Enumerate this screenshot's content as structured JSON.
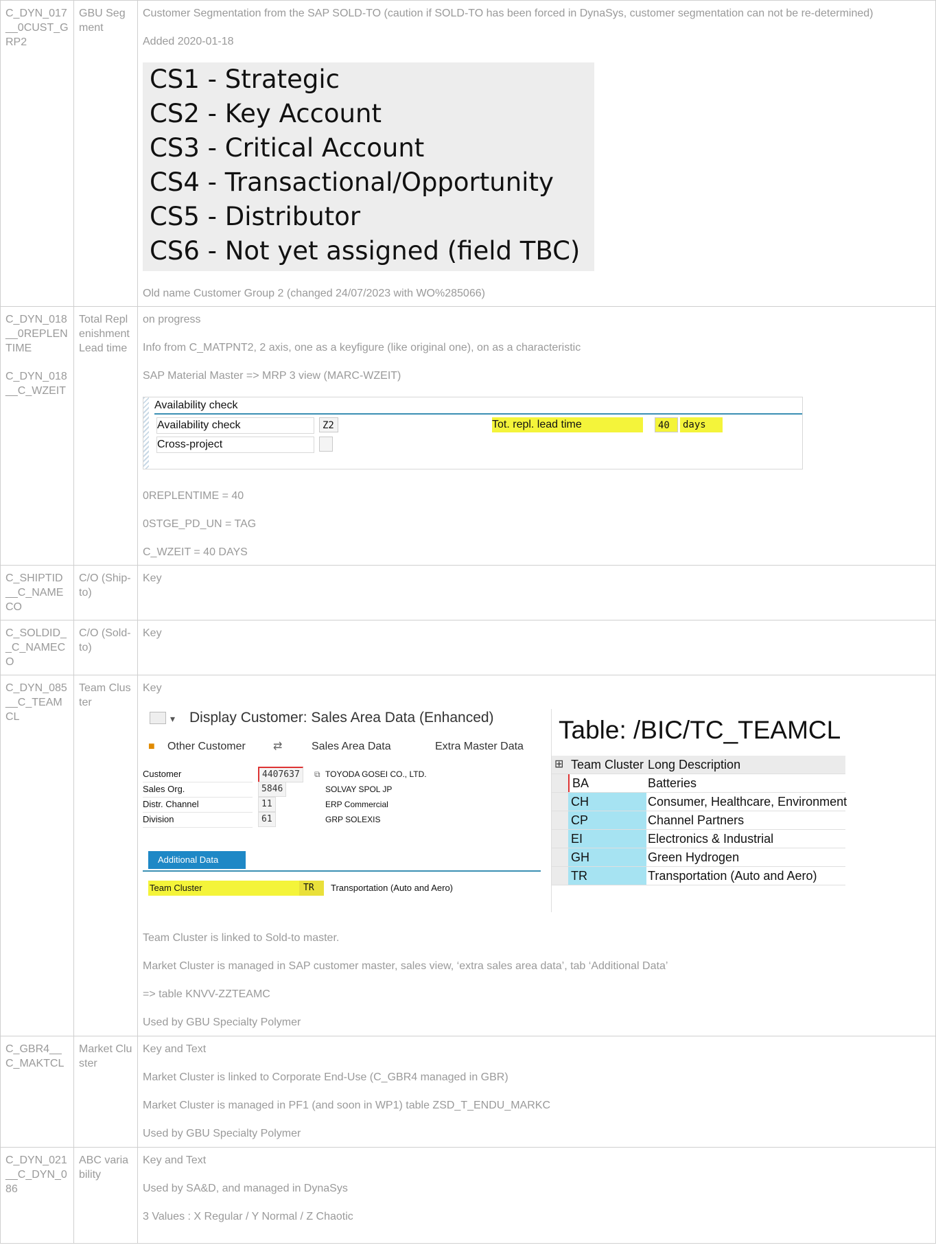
{
  "rows": [
    {
      "tech": "C_DYN_017__0CUST_GRP2",
      "desc": "GBU Segment",
      "paras": [
        "Customer Segmentation from the SAP SOLD-TO (caution if SOLD-TO has been forced in DynaSys, customer segmentation can not be re-determined)",
        "Added 2020-01-18"
      ],
      "cs_list": [
        "CS1 - Strategic",
        "CS2 - Key Account",
        "CS3 - Critical Account",
        "CS4 - Transactional/Opportunity",
        "CS5 - Distributor",
        "CS6 - Not yet assigned (field TBC)"
      ],
      "after": [
        "Old name Customer Group 2 (changed 24/07/2023 with WO%285066)"
      ]
    },
    {
      "tech1": "C_DYN_018__0REPLENTIME",
      "tech2": "C_DYN_018__C_WZEIT",
      "desc": "Total Replenishment Lead time",
      "paras": [
        "on progress",
        "Info from C_MATPNT2, 2 axis, one as a keyfigure (like original one), on as a characteristic",
        "SAP Material Master => MRP 3 view (MARC-WZEIT)"
      ],
      "avail": {
        "header": "Availability check",
        "label1": "Availability check",
        "value1": "Z2",
        "label2": "Cross-project",
        "value2": "",
        "lead_label": "Tot. repl. lead time",
        "lead_value": "40",
        "lead_unit": "days"
      },
      "after": [
        "0REPLENTIME = 40",
        "0STGE_PD_UN = TAG",
        "C_WZEIT = 40 DAYS"
      ]
    },
    {
      "tech": "C_SHIPTID__C_NAMECO",
      "desc": "C/O (Ship-to)",
      "paras": [
        "Key"
      ]
    },
    {
      "tech": "C_SOLDID__C_NAMECO",
      "desc": "C/O (Sold-to)",
      "paras": [
        "Key"
      ]
    },
    {
      "tech": "C_DYN_085__C_TEAMCL",
      "desc": "Team Cluster",
      "paras": [
        "Key"
      ],
      "sap": {
        "title": "Display Customer: Sales Area Data (Enhanced)",
        "tb_other": "Other Customer",
        "tb_sales": "Sales Area Data",
        "tb_extra": "Extra Master Data",
        "fields": [
          {
            "label": "Customer",
            "value": "4407637",
            "text": "TOYODA GOSEI CO., LTD."
          },
          {
            "label": "Sales Org.",
            "value": "5846",
            "text": "SOLVAY SPOL JP"
          },
          {
            "label": "Distr. Channel",
            "value": "11",
            "text": "ERP Commercial"
          },
          {
            "label": "Division",
            "value": "61",
            "text": "GRP SOLEXIS"
          }
        ],
        "tab": "Additional Data",
        "tc_label": "Team Cluster",
        "tc_value": "TR",
        "tc_text": "Transportation (Auto and Aero)"
      },
      "table": {
        "title": "Table: /BIC/TC_TEAMCL",
        "col1": "Team Cluster",
        "col2": "Long Description",
        "rows": [
          {
            "k": "BA",
            "d": "Batteries"
          },
          {
            "k": "CH",
            "d": "Consumer, Healthcare, Environment"
          },
          {
            "k": "CP",
            "d": "Channel Partners"
          },
          {
            "k": "EI",
            "d": "Electronics & Industrial"
          },
          {
            "k": "GH",
            "d": "Green Hydrogen"
          },
          {
            "k": "TR",
            "d": "Transportation (Auto and Aero)"
          }
        ]
      },
      "after": [
        "Team Cluster is linked to Sold-to master.",
        "Market Cluster is managed in SAP customer master, sales view,  ‘extra sales area data’, tab ‘Additional Data’",
        "=> table KNVV-ZZTEAMC",
        "Used by GBU Specialty Polymer"
      ]
    },
    {
      "tech": "C_GBR4__C_MAKTCL",
      "desc": "Market Cluster",
      "paras": [
        "Key and Text",
        "Market Cluster is linked to Corporate End-Use (C_GBR4 managed in GBR)",
        "Market Cluster is managed in PF1 (and soon in WP1) table ZSD_T_ENDU_MARKC",
        "Used by GBU Specialty Polymer"
      ]
    },
    {
      "tech": "C_DYN_021__C_DYN_086",
      "desc": "ABC variability",
      "paras": [
        "Key and Text",
        "Used by SA&D, and managed in DynaSys",
        "3 Values : X Regular / Y Normal / Z Chaotic"
      ]
    }
  ]
}
